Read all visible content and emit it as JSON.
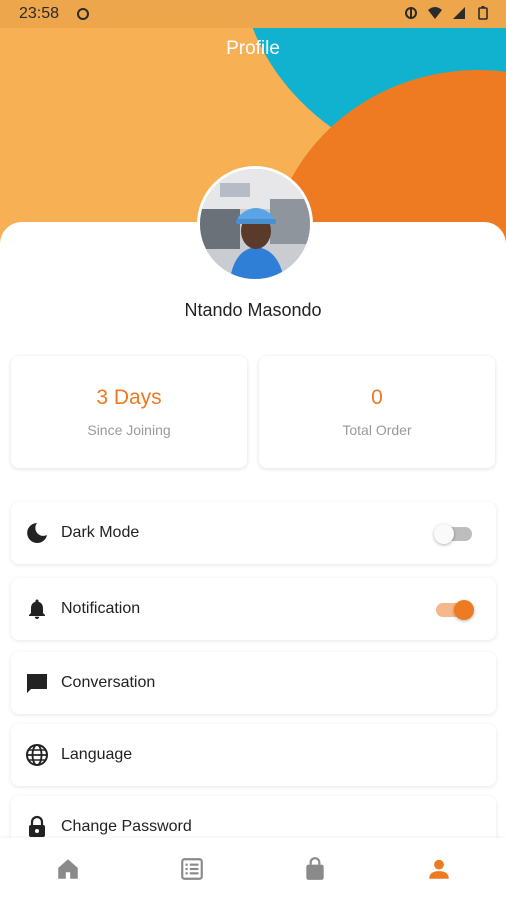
{
  "status_bar": {
    "time": "23:58"
  },
  "header": {
    "title": "Profile"
  },
  "profile": {
    "name": "Ntando Masondo"
  },
  "stats": [
    {
      "value": "3 Days",
      "label": "Since Joining"
    },
    {
      "value": "0",
      "label": "Total Order"
    }
  ],
  "settings": [
    {
      "label": "Dark Mode",
      "icon": "moon-icon",
      "toggle": false
    },
    {
      "label": "Notification",
      "icon": "bell-icon",
      "toggle": true
    },
    {
      "label": "Conversation",
      "icon": "chat-icon"
    },
    {
      "label": "Language",
      "icon": "globe-icon"
    },
    {
      "label": "Change Password",
      "icon": "lock-icon"
    }
  ],
  "bottom_nav": [
    {
      "icon": "home-icon",
      "active": false
    },
    {
      "icon": "orders-icon",
      "active": false
    },
    {
      "icon": "bag-icon",
      "active": false
    },
    {
      "icon": "profile-icon",
      "active": true
    }
  ],
  "colors": {
    "accent": "#EE7A22",
    "header_light_orange": "#F8B055",
    "header_cyan": "#10B2D0",
    "inactive_icon": "#8a8a8a"
  }
}
